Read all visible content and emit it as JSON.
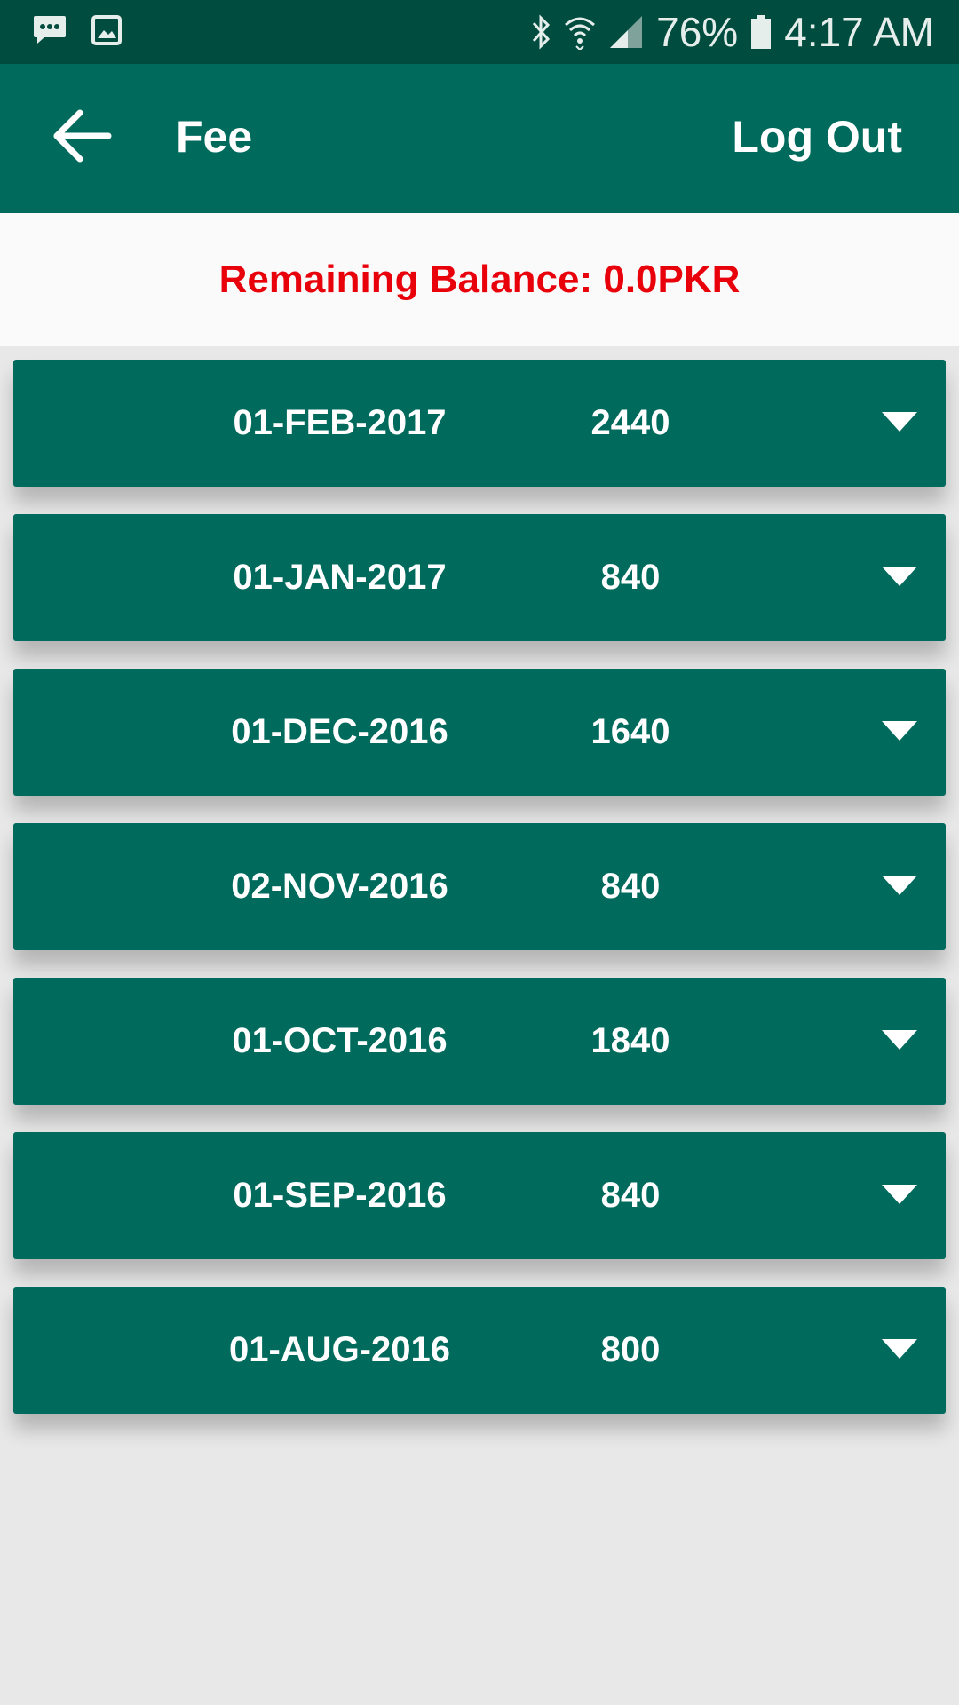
{
  "status_bar": {
    "battery_percent": "76%",
    "time": "4:17 AM",
    "icons": [
      "messages-icon",
      "gallery-icon",
      "bluetooth-icon",
      "wifi-icon",
      "signal-icon",
      "battery-icon"
    ]
  },
  "app_bar": {
    "title": "Fee",
    "logout_label": "Log Out",
    "back_icon": "arrow-left-icon"
  },
  "balance": {
    "label": "Remaining Balance: 0.0PKR",
    "color": "#e8000b"
  },
  "colors": {
    "primary": "#006a5c",
    "status_bar": "#004d40",
    "background": "#e8e8e8"
  },
  "fees": [
    {
      "date": "01-FEB-2017",
      "amount": "2440"
    },
    {
      "date": "01-JAN-2017",
      "amount": "840"
    },
    {
      "date": "01-DEC-2016",
      "amount": "1640"
    },
    {
      "date": "02-NOV-2016",
      "amount": "840"
    },
    {
      "date": "01-OCT-2016",
      "amount": "1840"
    },
    {
      "date": "01-SEP-2016",
      "amount": "840"
    },
    {
      "date": "01-AUG-2016",
      "amount": "800"
    }
  ]
}
